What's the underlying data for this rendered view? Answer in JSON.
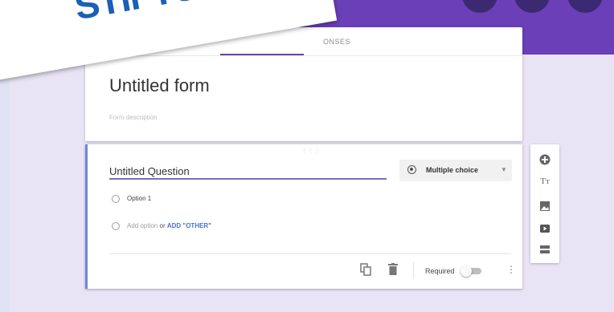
{
  "banner": {
    "text": "STIFTUNG"
  },
  "form": {
    "tab_responses": "ONSES",
    "title": "Untitled form",
    "description_placeholder": "Form description"
  },
  "question": {
    "title": "Untitled Question",
    "type_label": "Multiple choice",
    "options": [
      "Option 1"
    ],
    "add_option": "Add option",
    "or_text": "or",
    "add_other": "ADD \"OTHER\"",
    "required_label": "Required",
    "required_on": false
  },
  "colors": {
    "header": "#6a3fb8",
    "accent_border": "#6f86d6",
    "link": "#4a73c9",
    "banner_text": "#1b5fb6"
  },
  "toolbar": {
    "icons": [
      "add-question-icon",
      "title-text-icon",
      "image-icon",
      "video-icon",
      "section-icon"
    ]
  }
}
